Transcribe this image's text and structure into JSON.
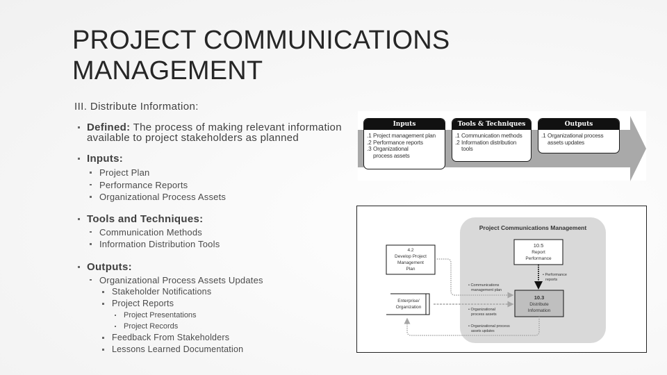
{
  "slide": {
    "title": "PROJECT COMMUNICATIONS MANAGEMENT",
    "title_line1": "PROJECT COMMUNICATIONS",
    "title_line2": "MANAGEMENT",
    "subtitle": "III. Distribute Information:",
    "bullets": {
      "defined": {
        "label": "Defined:",
        "text": " The process of making relevant information available to project stakeholders as planned"
      },
      "inputs": {
        "label": "Inputs:",
        "items": [
          "Project Plan",
          "Performance Reports",
          "Organizational Process Assets"
        ]
      },
      "tools": {
        "label": "Tools and Techniques:",
        "items": [
          "Communication Methods",
          "Information Distribution Tools"
        ]
      },
      "outputs": {
        "label": "Outputs:",
        "items": [
          {
            "label": "Organizational Process Assets Updates",
            "children": [
              {
                "label": "Stakeholder Notifications"
              },
              {
                "label": "Project Reports",
                "children": [
                  "Project Presentations",
                  "Project Records"
                ]
              },
              {
                "label": "Feedback From Stakeholders"
              },
              {
                "label": "Lessons Learned Documentation"
              }
            ]
          }
        ]
      }
    }
  },
  "itto_figure": {
    "inputs": {
      "header": "Inputs",
      "items": [
        {
          "num": ".1",
          "text": "Project management plan"
        },
        {
          "num": ".2",
          "text": "Performance reports"
        },
        {
          "num": ".3",
          "text": "Organizational process assets"
        }
      ]
    },
    "tools": {
      "header": "Tools & Techniques",
      "items": [
        {
          "num": ".1",
          "text": "Communication methods"
        },
        {
          "num": ".2",
          "text": "Information distribution tools"
        }
      ]
    },
    "outputs": {
      "header": "Outputs",
      "items": [
        {
          "num": ".1",
          "text": "Organizational process assets updates"
        }
      ]
    }
  },
  "process_diagram": {
    "group_title": "Project Communications Management",
    "nodes": {
      "develop_plan": {
        "id": "4.2",
        "line1": "Develop Project",
        "line2": "Management",
        "line3": "Plan"
      },
      "enterprise": {
        "line1": "Enterprise/",
        "line2": "Organization"
      },
      "report_performance": {
        "id": "10.5",
        "line1": "Report",
        "line2": "Performance"
      },
      "distribute_info": {
        "id": "10.3",
        "line1": "Distribute",
        "line2": "Information"
      }
    },
    "flows": {
      "performance_reports": {
        "line1": "• Performance",
        "line2": "reports"
      },
      "comm_plan": {
        "line1": "• Communications",
        "line2": "management plan"
      },
      "org_assets": {
        "line1": "• Organizational",
        "line2": "process assets"
      },
      "org_updates": {
        "line1": "• Organizational process",
        "line2": "assets updates"
      }
    },
    "colors": {
      "group_bg": "#d9d9d9",
      "highlight_node": "#bfbfbf",
      "flow_line": "#a6a6a6"
    }
  }
}
